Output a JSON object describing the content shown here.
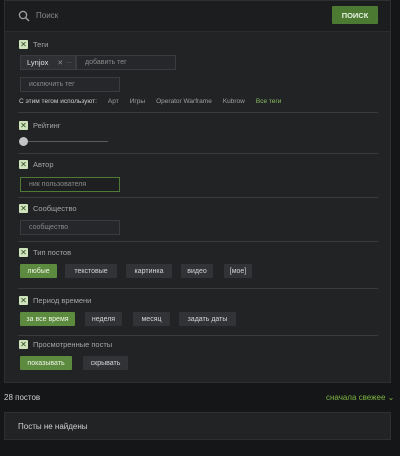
{
  "search": {
    "placeholder": "Поиск",
    "button_label": "ПОИСК"
  },
  "tags": {
    "title": "Теги",
    "chips": [
      "Lynjox"
    ],
    "add_placeholder": "добавить тег",
    "exclude_placeholder": "исключить тег",
    "related_label": "С этим тегом используют:",
    "related": [
      "Арт",
      "Игры",
      "Operator Warframe",
      "Kubrow"
    ],
    "all_tags": "Все теги"
  },
  "rating": {
    "title": "Рейтинг",
    "value": 0
  },
  "author": {
    "title": "Автор",
    "placeholder": "ник пользователя"
  },
  "community": {
    "title": "Сообщество",
    "placeholder": "сообщество"
  },
  "post_type": {
    "title": "Тип постов",
    "options": [
      "любые",
      "текстовые",
      "картинка",
      "видео",
      "[мое]"
    ],
    "selected": "любые"
  },
  "period": {
    "title": "Период времени",
    "options": [
      "за все время",
      "неделя",
      "месяц",
      "задать даты"
    ],
    "selected": "за все время"
  },
  "viewed": {
    "title": "Просмотренные посты",
    "options": [
      "показывать",
      "скрывать"
    ],
    "selected": "показывать"
  },
  "checkbox_mark": "✕",
  "results": {
    "count": "28 постов",
    "sort": "сначала свежее ⌄",
    "empty": "Посты не найдены"
  },
  "colors": {
    "accent": "#5c8a3e",
    "link": "#7cb342",
    "panel": "#222325",
    "background": "#151618"
  }
}
